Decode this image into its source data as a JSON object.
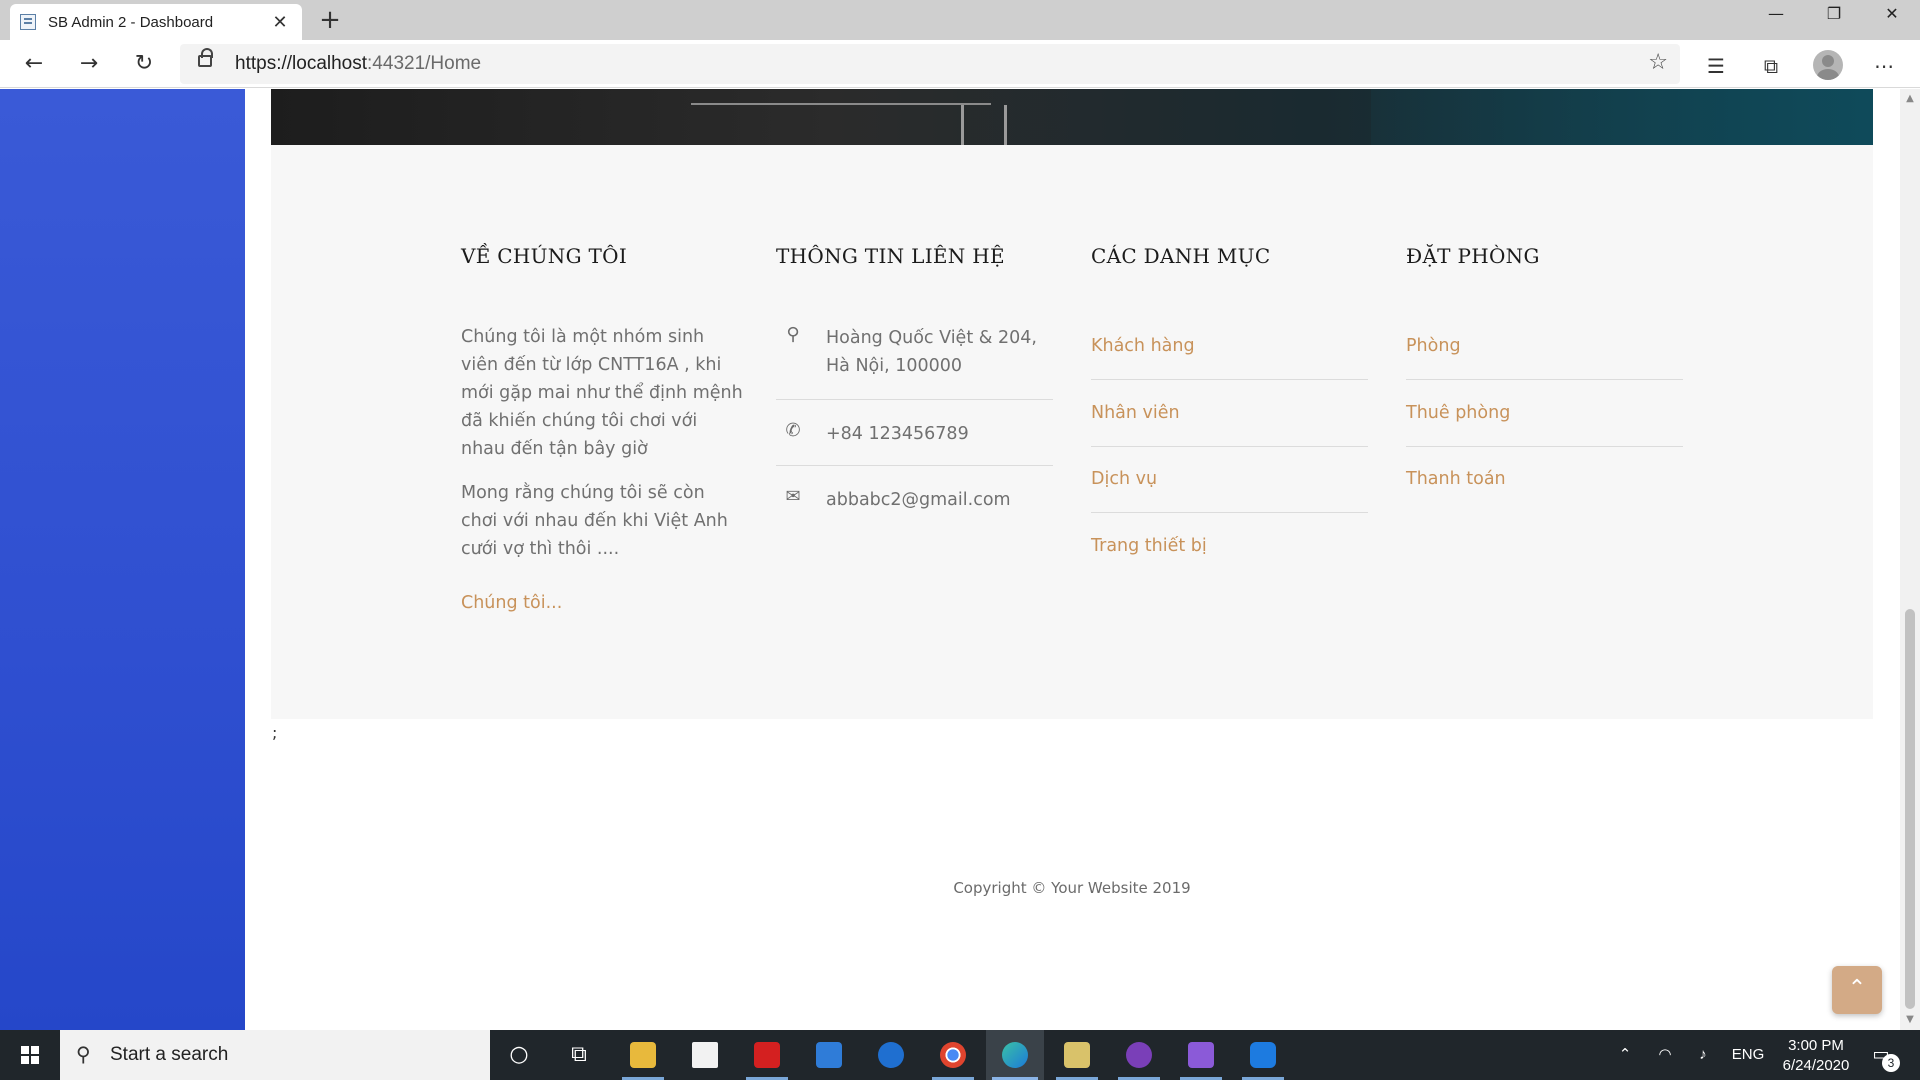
{
  "browser": {
    "tab_title": "SB Admin 2 - Dashboard",
    "tab_close": "✕",
    "new_tab": "+",
    "window_controls": {
      "minimize": "—",
      "restore": "❐",
      "close": "✕"
    },
    "url_host": "https://localhost",
    "url_port": ":44321",
    "url_path": "/Home",
    "nav": {
      "back": "←",
      "forward": "→",
      "refresh": "↻"
    },
    "toolbar_icons": [
      "favorite-star-icon",
      "favorites-list-icon",
      "collections-icon",
      "profile-avatar",
      "more-menu-icon"
    ]
  },
  "footer": {
    "about": {
      "heading": "VỀ CHÚNG TÔI",
      "paragraph1": "Chúng tôi là một nhóm sinh viên đến từ lớp CNTT16A , khi mới gặp mai như thể định mệnh đã khiến chúng tôi chơi với nhau đến tận bây giờ",
      "paragraph2": "Mong rằng chúng tôi sẽ còn chơi với nhau đến khi Việt Anh cưới vợ thì thôi ....",
      "more_link": "Chúng tôi..."
    },
    "contact": {
      "heading": "THÔNG TIN LIÊN HỆ",
      "address": "Hoàng Quốc Việt & 204, Hà Nội, 100000",
      "phone": "+84 123456789",
      "email": "abbabc2@gmail.com"
    },
    "categories": {
      "heading": "CÁC DANH MỤC",
      "items": [
        "Khách hàng",
        "Nhân viên",
        "Dịch vụ",
        "Trang thiết bị"
      ]
    },
    "booking": {
      "heading": "ĐẶT PHÒNG",
      "items": [
        "Phòng",
        "Thuê phòng",
        "Thanh toán"
      ]
    }
  },
  "stray_text": ";",
  "copyright": "Copyright © Your Website 2019",
  "taskbar": {
    "search_placeholder": "Start a search",
    "language": "ENG",
    "time": "3:00 PM",
    "date": "6/24/2020",
    "notification_count": "3"
  },
  "colors": {
    "sidebar": "#2f4fd0",
    "link": "#c8925a",
    "footer_bg": "#f7f7f7",
    "scroll_top_button": "#d3aa86",
    "taskbar": "#20262b"
  }
}
